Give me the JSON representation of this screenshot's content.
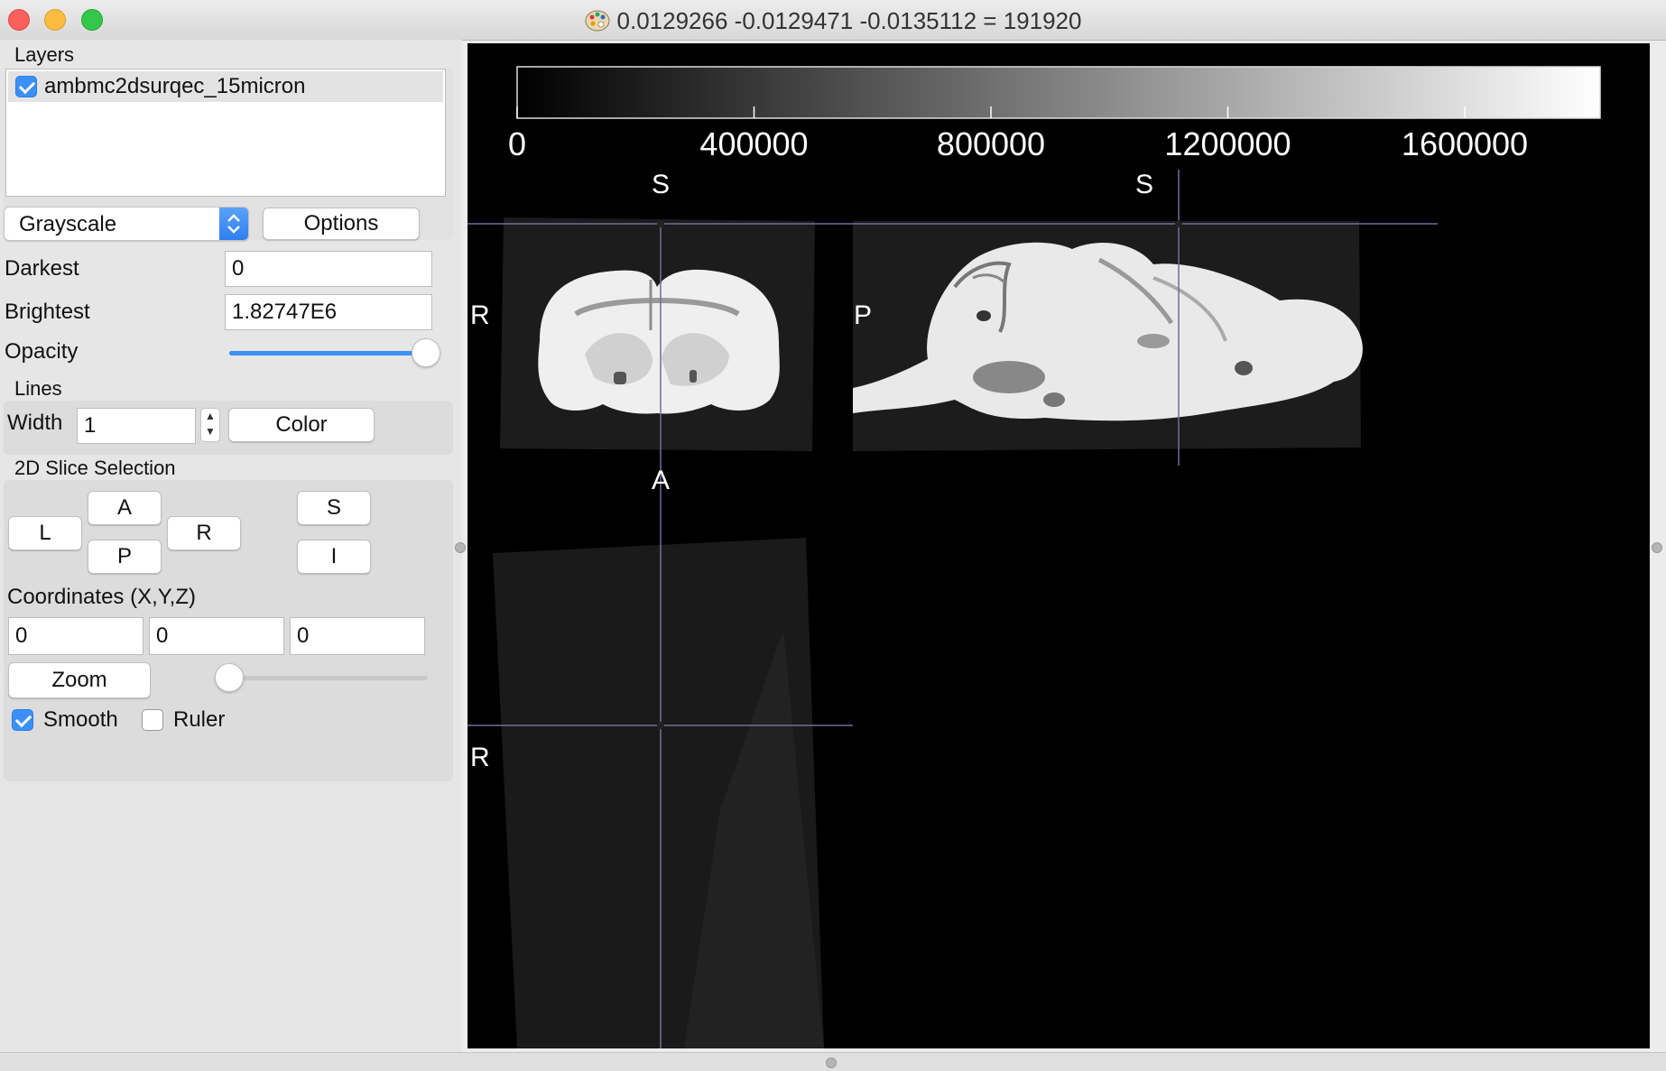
{
  "window": {
    "title": "0.0129266 -0.0129471 -0.0135112 =  191920",
    "app_icon": "palette-icon"
  },
  "layers": {
    "section_label": "Layers",
    "items": [
      {
        "name": "ambmc2dsurqec_15micron",
        "checked": true
      }
    ]
  },
  "colormap": {
    "selected": "Grayscale",
    "options_label": "Options",
    "darkest_label": "Darkest",
    "darkest_value": "0",
    "brightest_label": "Brightest",
    "brightest_value": "1.82747E6",
    "opacity_label": "Opacity",
    "opacity_value": 1.0
  },
  "lines": {
    "section_label": "Lines",
    "width_label": "Width",
    "width_value": "1",
    "color_label": "Color"
  },
  "slice_selection": {
    "section_label": "2D Slice Selection",
    "buttons": {
      "L": "L",
      "A": "A",
      "P": "P",
      "R": "R",
      "S": "S",
      "I": "I"
    },
    "coordinates_label": "Coordinates (X,Y,Z)",
    "x": "0",
    "y": "0",
    "z": "0",
    "zoom_label": "Zoom",
    "zoom_value": 0.0,
    "smooth_label": "Smooth",
    "smooth_checked": true,
    "ruler_label": "Ruler",
    "ruler_checked": false
  },
  "viewer": {
    "colorbar_ticks": [
      "0",
      "400000",
      "800000",
      "1200000",
      "1600000"
    ],
    "orientation_labels": {
      "coronal_top": "S",
      "coronal_left": "R",
      "coronal_bottom": "A",
      "sagittal_top": "S",
      "sagittal_left": "P",
      "axial_left": "R"
    },
    "crosshair_color": "#6f6f9a"
  }
}
